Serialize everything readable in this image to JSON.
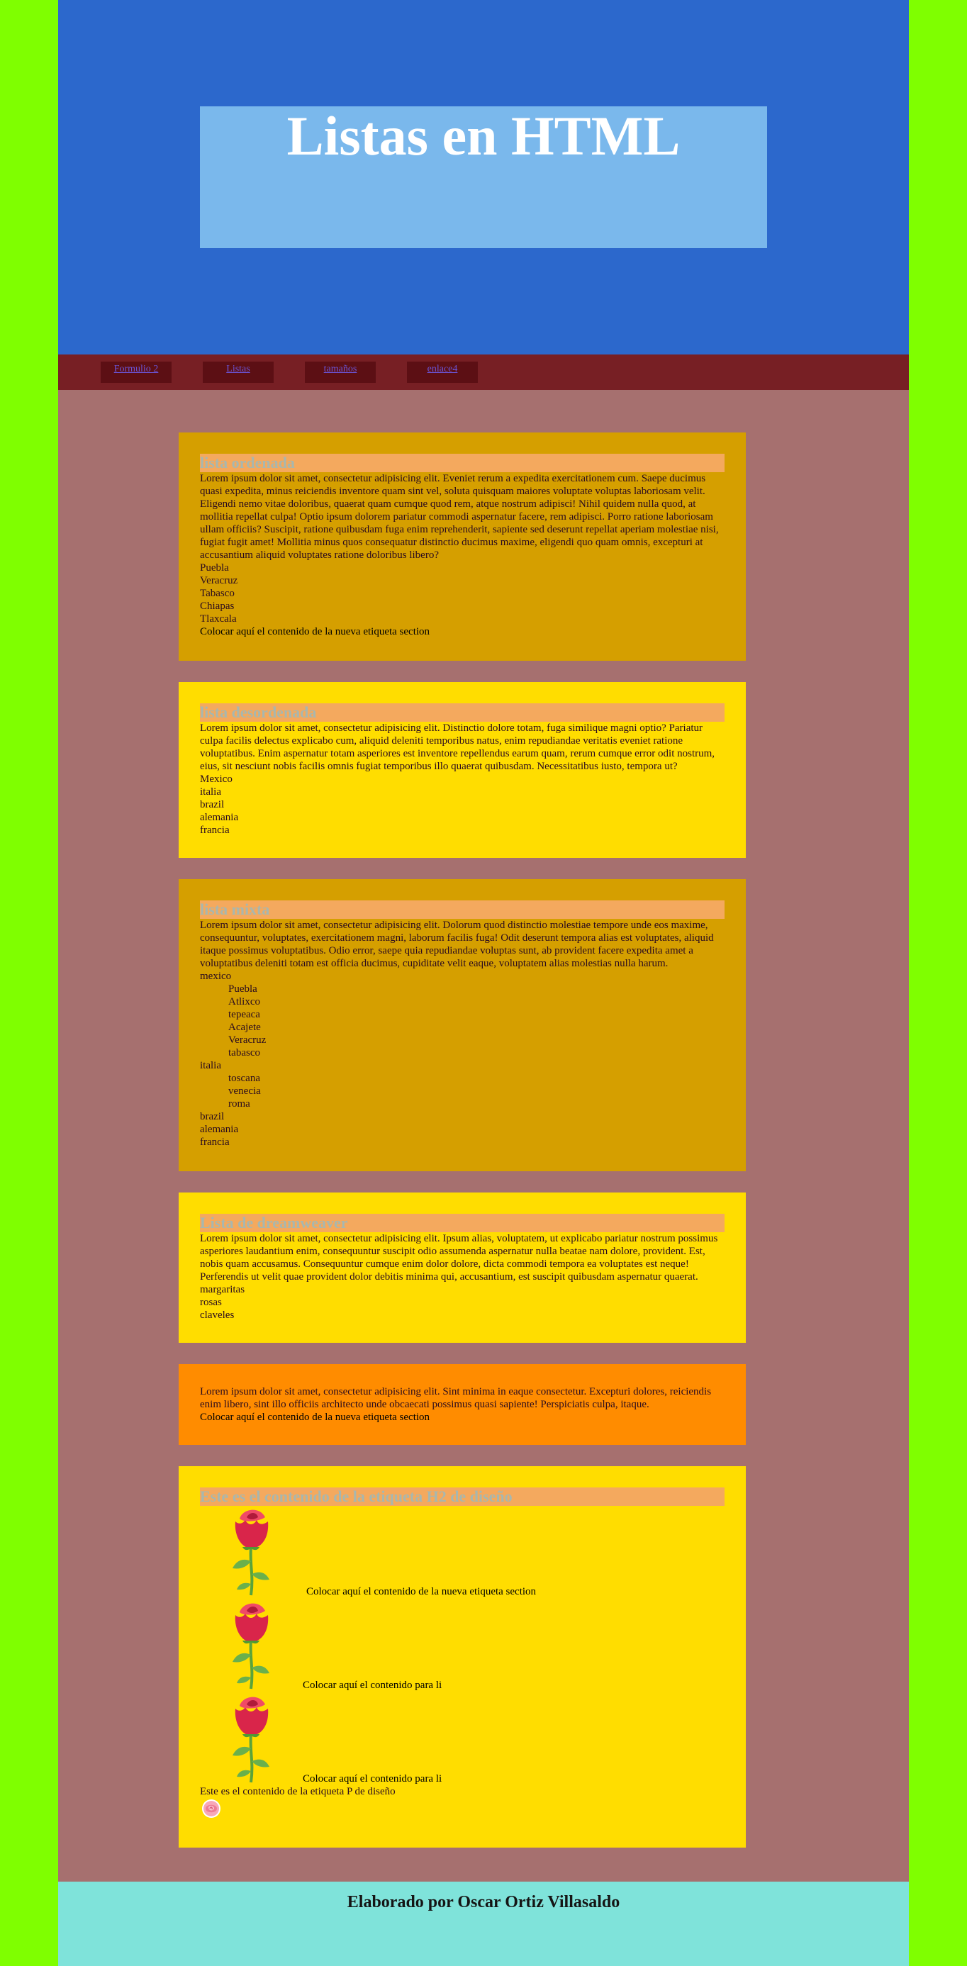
{
  "header": {
    "title": "Listas en HTML"
  },
  "nav": {
    "items": [
      "Formulio 2",
      "Listas",
      "tamaños",
      "enlace4"
    ]
  },
  "ordered": {
    "heading": "lista ordenada",
    "text": "Lorem ipsum dolor sit amet, consectetur adipisicing elit. Eveniet rerum a expedita exercitationem cum. Saepe ducimus quasi expedita, minus reiciendis inventore quam sint vel, soluta quisquam maiores voluptate voluptas laboriosam velit. Eligendi nemo vitae doloribus, quaerat quam cumque quod rem, atque nostrum adipisci! Nihil quidem nulla quod, at mollitia repellat culpa! Optio ipsum dolorem pariatur commodi aspernatur facere, rem adipisci. Porro ratione laboriosam ullam officiis? Suscipit, ratione quibusdam fuga enim reprehenderit, sapiente sed deserunt repellat aperiam molestiae nisi, fugiat fugit amet! Mollitia minus quos consequatur distinctio ducimus maxime, eligendi quo quam omnis, excepturi at accusantium aliquid voluptates ratione doloribus libero?",
    "items": [
      "Puebla",
      "Veracruz",
      "Tabasco",
      "Chiapas",
      "Tlaxcala"
    ],
    "footer": "Colocar aquí el contenido de la nueva etiqueta section"
  },
  "unordered": {
    "heading": "lista desordenada",
    "text": "Lorem ipsum dolor sit amet, consectetur adipisicing elit. Distinctio dolore totam, fuga similique magni optio? Pariatur culpa facilis delectus explicabo cum, aliquid deleniti temporibus natus, enim repudiandae veritatis eveniet ratione voluptatibus. Enim aspernatur totam asperiores est inventore repellendus earum quam, rerum cumque error odit nostrum, eius, sit nesciunt nobis facilis omnis fugiat temporibus illo quaerat quibusdam. Necessitatibus iusto, tempora ut?",
    "items": [
      "Mexico",
      "italia",
      "brazil",
      "alemania",
      "francia"
    ]
  },
  "mixed": {
    "heading": "lista mixta",
    "text": "Lorem ipsum dolor sit amet, consectetur adipisicing elit. Dolorum quod distinctio molestiae tempore unde eos maxime, consequuntur, voluptates, exercitationem magni, laborum facilis fuga! Odit deserunt tempora alias est voluptates, aliquid itaque possimus voluptatibus. Odio error, saepe quia repudiandae voluptas sunt, ab provident facere expedita amet a voluptatibus deleniti totam est officia ducimus, cupiditate velit eaque, voluptatem alias molestias nulla harum.",
    "mexico": "mexico",
    "mexico_items": [
      "Puebla",
      "Atlixco",
      "tepeaca",
      "Acajete",
      "Veracruz",
      "tabasco"
    ],
    "italia": "italia",
    "italia_items": [
      "toscana",
      "venecia",
      "roma"
    ],
    "rest": [
      "brazil",
      "alemania",
      "francia"
    ]
  },
  "dreamweaver": {
    "heading": "Lista de dreamweaver",
    "text": "Lorem ipsum dolor sit amet, consectetur adipisicing elit. Ipsum alias, voluptatem, ut explicabo pariatur nostrum possimus asperiores laudantium enim, consequuntur suscipit odio assumenda aspernatur nulla beatae nam dolore, provident. Est, nobis quam accusamus. Consequuntur cumque enim dolor dolore, dicta commodi tempora ea voluptates est neque! Perferendis ut velit quae provident dolor debitis minima qui, accusantium, est suscipit quibusdam aspernatur quaerat.",
    "items": [
      "margaritas",
      "rosas",
      "claveles"
    ]
  },
  "orange": {
    "text": "Lorem ipsum dolor sit amet, consectetur adipisicing elit. Sint minima in eaque consectetur. Excepturi dolores, reiciendis enim libero, sint illo officiis architecto unde obcaecati possimus quasi sapiente! Perspiciatis culpa, itaque.",
    "footer": "Colocar aquí el contenido de la nueva etiqueta section"
  },
  "design": {
    "heading": "Este es el contenido de la etiqueta H2 de diseño",
    "items": [
      "Colocar aquí el contenido de la nueva etiqueta section",
      "Colocar aquí el contenido para li",
      "Colocar aquí el contenido para li"
    ],
    "paragraph": "Este es el contenido de la etiqueta P de diseño",
    "rose_icon": "rose-icon"
  },
  "footer": {
    "text": "Elaborado por Oscar Ortiz Villasaldo"
  },
  "colors": {
    "background": "#7fff00",
    "header": "#2c68cc",
    "title_box": "#7ab8ec",
    "nav": "#771f24",
    "main": "#a6706f",
    "dark_yellow": "#d59f00",
    "yellow": "#ffdd00",
    "orange": "#ff8c00",
    "footer": "#7fe3da"
  }
}
